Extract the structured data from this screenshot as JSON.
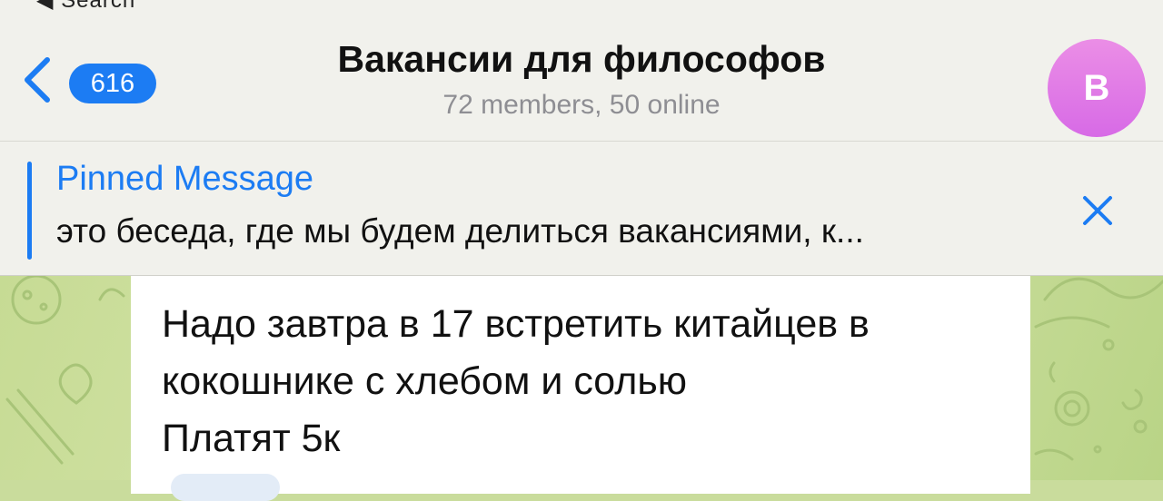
{
  "top_bar": {
    "back_to_label": "◀ Search"
  },
  "header": {
    "unread_count": "616",
    "title": "Вакансии для философов",
    "subtitle": "72 members, 50 online",
    "avatar_letter": "В",
    "avatar_color": "#d76ae6"
  },
  "pinned": {
    "label": "Pinned Message",
    "text": "это беседа, где мы будем делиться вакансиями, к..."
  },
  "message": {
    "lines": [
      "Надо завтра в 17 встретить китайцев в",
      "кокошнике с хлебом и солью",
      "Платят 5к"
    ]
  },
  "colors": {
    "accent": "#1c7cf3",
    "header_bg": "#f1f1ec",
    "wallpaper": "#cfe0a3"
  },
  "icons": {
    "back": "chevron-left-icon",
    "close": "close-icon"
  }
}
